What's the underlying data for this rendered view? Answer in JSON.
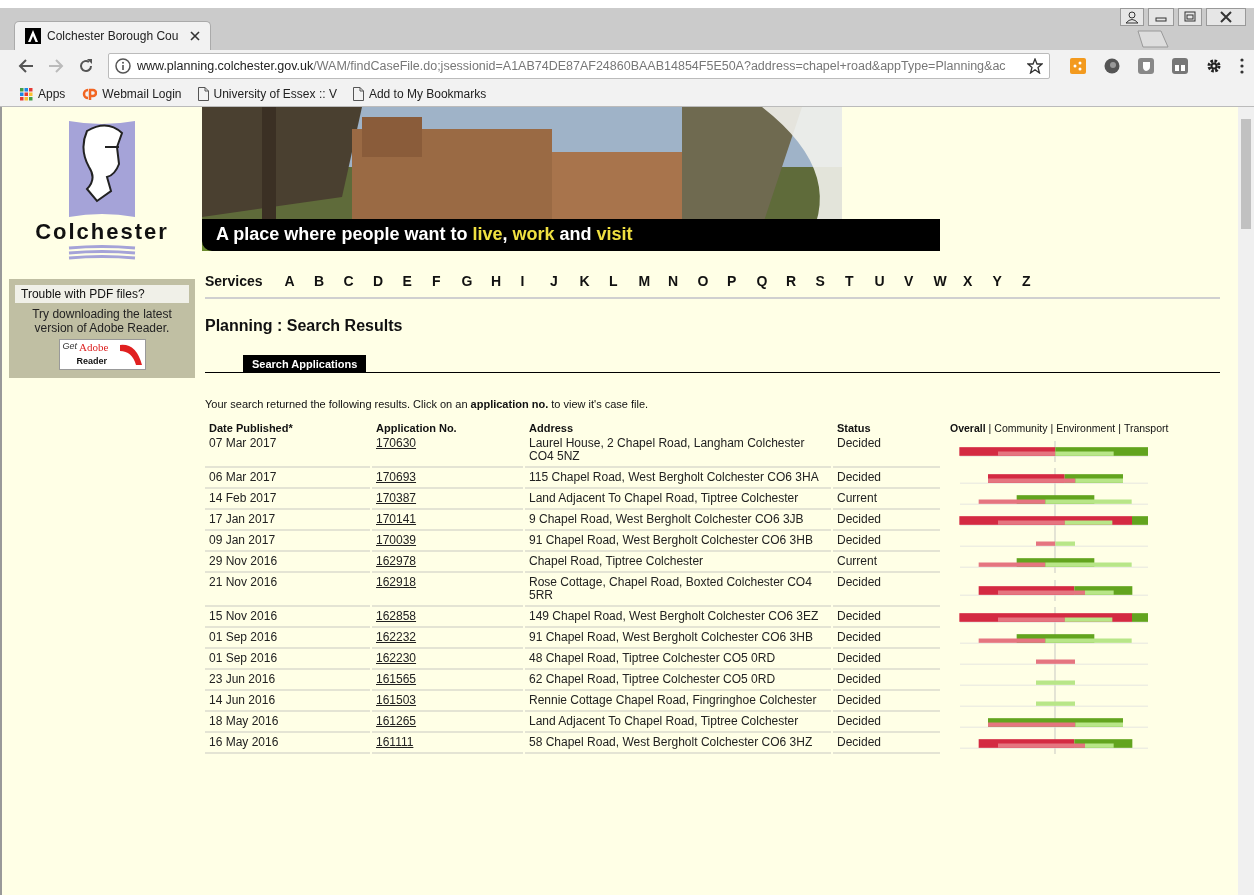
{
  "browser": {
    "tab_title": "Colchester Borough Cou",
    "url_host": "www.planning.colchester.gov.uk",
    "url_path": "/WAM/findCaseFile.do;jsessionid=A1AB74DE87AF24860BAAB14854F5E50A?address=chapel+road&appType=Planning&ac",
    "bookmarks": [
      {
        "kind": "apps",
        "label": "Apps"
      },
      {
        "kind": "webmail",
        "label": "Webmail Login"
      },
      {
        "kind": "page",
        "label": "University of Essex :: V"
      },
      {
        "kind": "page",
        "label": "Add to My Bookmarks"
      }
    ]
  },
  "sidebar": {
    "logo_text": "Colchester",
    "pdf_title": "Trouble with PDF files?",
    "pdf_text": "Try downloading the latest version of Adobe Reader.",
    "badge_get": "Get",
    "badge_adobe": "Adobe",
    "badge_reader": "Reader"
  },
  "banner": {
    "caption": [
      {
        "text": "A place where people want to ",
        "highlight": false
      },
      {
        "text": "live",
        "highlight": true
      },
      {
        "text": ", ",
        "highlight": false
      },
      {
        "text": "work",
        "highlight": true
      },
      {
        "text": " and ",
        "highlight": false
      },
      {
        "text": "visit",
        "highlight": true
      }
    ]
  },
  "nav": {
    "label": "Services",
    "letters": [
      "A",
      "B",
      "C",
      "D",
      "E",
      "F",
      "G",
      "H",
      "I",
      "J",
      "K",
      "L",
      "M",
      "N",
      "O",
      "P",
      "Q",
      "R",
      "S",
      "T",
      "U",
      "V",
      "W",
      "X",
      "Y",
      "Z"
    ]
  },
  "heading": "Planning : Search Results",
  "tabs": [
    {
      "label": "Search Applications",
      "selected": true
    }
  ],
  "intro": "Your search returned the following results. Click on an **application no.** to view it's case file.",
  "table": {
    "columns": [
      "Date Published*",
      "Application No.",
      "Address",
      "Status"
    ],
    "chart_separator": "|",
    "chart_tabs": [
      {
        "label": "Overall",
        "selected": true
      },
      {
        "label": "Community",
        "selected": false
      },
      {
        "label": "Environment",
        "selected": false
      },
      {
        "label": "Transport",
        "selected": false
      }
    ],
    "rows": [
      {
        "date": "07 Mar 2017",
        "app_no": "170630",
        "address": "Laurel House, 2 Chapel Road, Langham Colchester CO4 5NZ",
        "status": "Decided"
      },
      {
        "date": "06 Mar 2017",
        "app_no": "170693",
        "address": "115 Chapel Road, West Bergholt Colchester CO6 3HA",
        "status": "Decided"
      },
      {
        "date": "14 Feb 2017",
        "app_no": "170387",
        "address": "Land Adjacent To Chapel Road, Tiptree Colchester",
        "status": "Current"
      },
      {
        "date": "17 Jan 2017",
        "app_no": "170141",
        "address": "9 Chapel Road, West Bergholt Colchester CO6 3JB",
        "status": "Decided"
      },
      {
        "date": "09 Jan 2017",
        "app_no": "170039",
        "address": "91 Chapel Road, West Bergholt Colchester CO6 3HB",
        "status": "Decided"
      },
      {
        "date": "29 Nov 2016",
        "app_no": "162978",
        "address": "Chapel Road, Tiptree Colchester",
        "status": "Current"
      },
      {
        "date": "21 Nov 2016",
        "app_no": "162918",
        "address": "Rose Cottage, Chapel Road, Boxted Colchester CO4 5RR",
        "status": "Decided"
      },
      {
        "date": "15 Nov 2016",
        "app_no": "162858",
        "address": "149 Chapel Road, West Bergholt Colchester CO6 3EZ",
        "status": "Decided"
      },
      {
        "date": "01 Sep 2016",
        "app_no": "162232",
        "address": "91 Chapel Road, West Bergholt Colchester CO6 3HB",
        "status": "Decided"
      },
      {
        "date": "01 Sep 2016",
        "app_no": "162230",
        "address": "48 Chapel Road, Tiptree Colchester CO5 0RD",
        "status": "Decided"
      },
      {
        "date": "23 Jun 2016",
        "app_no": "161565",
        "address": "62 Chapel Road, Tiptree Colchester CO5 0RD",
        "status": "Decided"
      },
      {
        "date": "14 Jun 2016",
        "app_no": "161503",
        "address": "Rennie Cottage Chapel Road, Fingringhoe Colchester",
        "status": "Decided"
      },
      {
        "date": "18 May 2016",
        "app_no": "161265",
        "address": "Land Adjacent To Chapel Road, Tiptree Colchester",
        "status": "Decided"
      },
      {
        "date": "16 May 2016",
        "app_no": "161111",
        "address": "58 Chapel Road, West Bergholt Colchester CO6 3HZ",
        "status": "Decided"
      }
    ]
  }
}
